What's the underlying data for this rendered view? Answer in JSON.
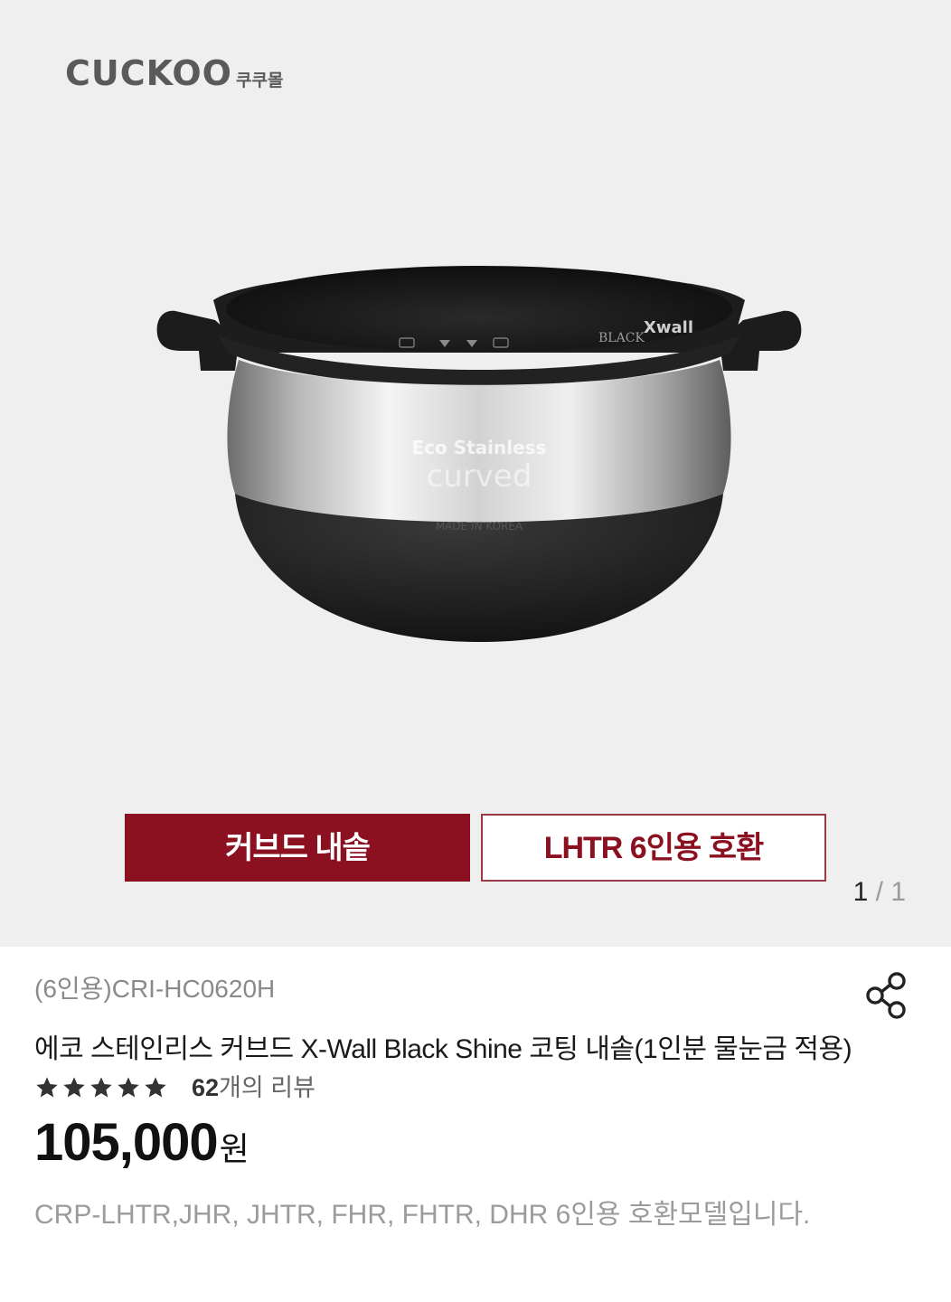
{
  "brand": {
    "logo_text": "CUCKOO",
    "sub_text": "쿠쿠몰"
  },
  "gallery": {
    "image_icon": "inner-pot-product-image",
    "pot_labels": {
      "engraving_line1": "Eco Stainless",
      "engraving_line2": "curved",
      "made_in": "MADE IN KOREA",
      "inner_mark": "Xwall",
      "inner_mark_sub": "BLACK"
    },
    "tags": [
      {
        "label": "커브드 내솥",
        "style": "primary"
      },
      {
        "label": "LHTR 6인용 호환",
        "style": "secondary"
      }
    ],
    "pager": {
      "current": "1",
      "separator": "/",
      "total": "1"
    }
  },
  "product": {
    "model": "(6인용)CRI-HC0620H",
    "title": "에코 스테인리스 커브드 X-Wall Black Shine 코팅 내솥(1인분 물눈금 적용)",
    "rating_stars": 5,
    "review_count": "62",
    "review_suffix": "개의 리뷰",
    "price": "105,000",
    "price_unit": "원",
    "description": "CRP-LHTR,JHR, JHTR, FHR, FHTR, DHR 6인용 호환모델입니다."
  },
  "icons": {
    "share": "share-icon",
    "star": "star-icon"
  },
  "colors": {
    "accent": "#8b1020",
    "gallery_bg": "#efefef",
    "muted_text": "#9b9b9b",
    "star": "#333333"
  }
}
